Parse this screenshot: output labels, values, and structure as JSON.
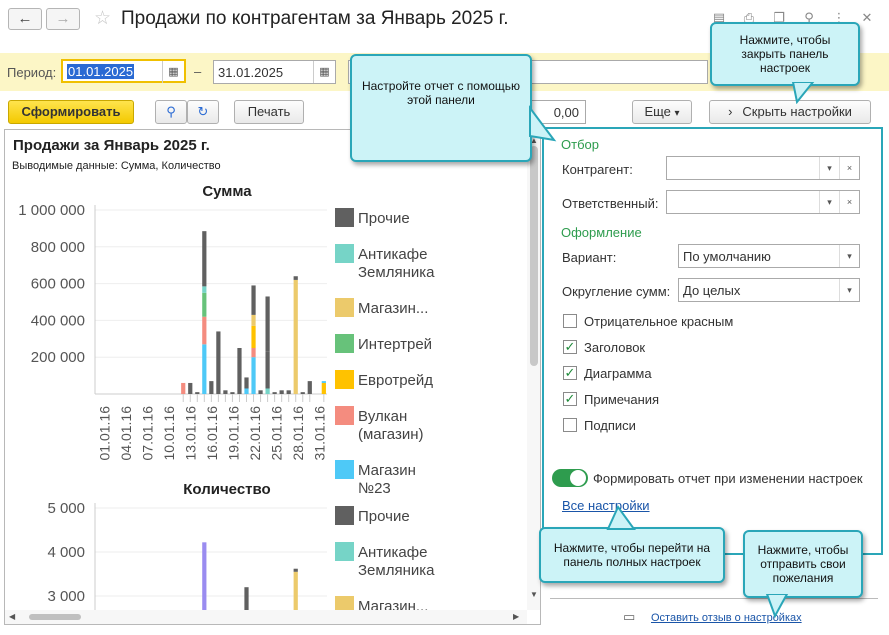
{
  "window": {
    "back_icon": "←",
    "forward_icon": "→",
    "title": "Продажи по контрагентам за Январь 2025 г."
  },
  "params": {
    "period_label": "Период:",
    "date_from": "01.01.2025",
    "dash": "–",
    "date_to": "31.01.2025"
  },
  "toolbar": {
    "generate": "Сформировать",
    "print": "Печать",
    "sum_value": "0,00",
    "more": "Еще",
    "more_arrow": "▾",
    "hide_settings": "Скрыть настройки",
    "hide_arrow": "›"
  },
  "report": {
    "title": "Продажи за Январь 2025 г.",
    "subtitle": "Выводимые данные: Сумма, Количество"
  },
  "chart_data": [
    {
      "type": "bar",
      "stacked": true,
      "title": "Сумма",
      "ylim": [
        0,
        1000000
      ],
      "yticks": [
        "1 000 000",
        "800 000",
        "600 000",
        "400 000",
        "200 000"
      ],
      "xticks": [
        "01.01.16",
        "04.01.16",
        "07.01.16",
        "10.01.16",
        "13.01.16",
        "16.01.16",
        "19.01.16",
        "22.01.16",
        "25.01.16",
        "28.01.16",
        "31.01.16"
      ],
      "legend_position": "right",
      "series": [
        {
          "name": "Прочие",
          "color": "#606060"
        },
        {
          "name": "Антикафе Земляника",
          "color": "#76d4c7"
        },
        {
          "name": "Магазин...",
          "color": "#ecca6b"
        },
        {
          "name": "Интертрейд",
          "color": "#67c27a"
        },
        {
          "name": "Евротрейд",
          "color": "#ffc200"
        },
        {
          "name": "Вулкан (магазин)",
          "color": "#f48c7f"
        },
        {
          "name": "Магазин №23",
          "color": "#4ec9f7"
        }
      ],
      "legend_labels": [
        "Прочие",
        "Антикафе",
        "Земляника",
        "Магазин...",
        "Интертрей",
        "Евротрейд",
        "Вулкан",
        "(магазин)",
        "Магазин",
        "№23"
      ],
      "bars": [
        {
          "day": 13,
          "segments": [
            {
              "s": 5,
              "v": 60000
            }
          ]
        },
        {
          "day": 14,
          "segments": [
            {
              "s": 0,
              "v": 60000
            }
          ]
        },
        {
          "day": 15,
          "segments": [
            {
              "s": 0,
              "v": 10000
            }
          ]
        },
        {
          "day": 16,
          "segments": [
            {
              "s": 6,
              "v": 270000
            },
            {
              "s": 5,
              "v": 150000
            },
            {
              "s": 3,
              "v": 130000
            },
            {
              "s": 1,
              "v": 35000
            },
            {
              "s": 0,
              "v": 300000
            }
          ]
        },
        {
          "day": 17,
          "segments": [
            {
              "s": 0,
              "v": 70000
            }
          ]
        },
        {
          "day": 18,
          "segments": [
            {
              "s": 0,
              "v": 340000
            }
          ]
        },
        {
          "day": 19,
          "segments": [
            {
              "s": 0,
              "v": 20000
            }
          ]
        },
        {
          "day": 20,
          "segments": [
            {
              "s": 0,
              "v": 10000
            }
          ]
        },
        {
          "day": 21,
          "segments": [
            {
              "s": 0,
              "v": 250000
            }
          ]
        },
        {
          "day": 22,
          "segments": [
            {
              "s": 6,
              "v": 30000
            },
            {
              "s": 0,
              "v": 60000
            }
          ]
        },
        {
          "day": 23,
          "segments": [
            {
              "s": 6,
              "v": 200000
            },
            {
              "s": 5,
              "v": 50000
            },
            {
              "s": 4,
              "v": 120000
            },
            {
              "s": 2,
              "v": 60000
            },
            {
              "s": 0,
              "v": 160000
            }
          ]
        },
        {
          "day": 24,
          "segments": [
            {
              "s": 0,
              "v": 20000
            }
          ]
        },
        {
          "day": 25,
          "segments": [
            {
              "s": 1,
              "v": 30000
            },
            {
              "s": 0,
              "v": 200000
            },
            {
              "s": 0,
              "v": 300000
            }
          ]
        },
        {
          "day": 26,
          "segments": [
            {
              "s": 0,
              "v": 10000
            }
          ]
        },
        {
          "day": 27,
          "segments": [
            {
              "s": 0,
              "v": 20000
            }
          ]
        },
        {
          "day": 28,
          "segments": [
            {
              "s": 0,
              "v": 20000
            }
          ]
        },
        {
          "day": 29,
          "segments": [
            {
              "s": 2,
              "v": 620000
            },
            {
              "s": 0,
              "v": 20000
            }
          ]
        },
        {
          "day": 30,
          "segments": [
            {
              "s": 0,
              "v": 10000
            }
          ]
        },
        {
          "day": 31,
          "segments": [
            {
              "s": 0,
              "v": 70000
            }
          ]
        },
        {
          "day": 33,
          "segments": [
            {
              "s": 4,
              "v": 60000
            },
            {
              "s": 6,
              "v": 10000
            }
          ]
        }
      ]
    },
    {
      "type": "bar",
      "stacked": true,
      "title": "Количество",
      "ylim": [
        2500,
        5000
      ],
      "yticks": [
        "5 000",
        "4 000",
        "3 000"
      ],
      "legend_position": "right",
      "legend_labels": [
        "Прочие",
        "Антикафе",
        "Земляника",
        "Магазин..."
      ],
      "bars": [
        {
          "day": 16,
          "segments": [
            {
              "s": 7,
              "v": 4220
            },
            {
              "s": 0,
              "v": 4000
            }
          ]
        },
        {
          "day": 22,
          "segments": [
            {
              "s": 0,
              "v": 3200
            }
          ]
        },
        {
          "day": 23,
          "segments": [
            {
              "s": 0,
              "v": 2500
            }
          ]
        },
        {
          "day": 29,
          "segments": [
            {
              "s": 2,
              "v": 3550
            },
            {
              "s": 0,
              "v": 3620
            }
          ]
        }
      ]
    }
  ],
  "settings": {
    "group_filter": "Отбор",
    "counterparty_label": "Контрагент:",
    "responsible_label": "Ответственный:",
    "group_design": "Оформление",
    "variant_label": "Вариант:",
    "variant_value": "По умолчанию",
    "rounding_label": "Округление сумм:",
    "rounding_value": "До целых",
    "checkboxes": [
      {
        "label": "Отрицательное красным",
        "checked": false
      },
      {
        "label": "Заголовок",
        "checked": true
      },
      {
        "label": "Диаграмма",
        "checked": true
      },
      {
        "label": "Примечания",
        "checked": true
      },
      {
        "label": "Подписи",
        "checked": false
      }
    ],
    "auto_generate_label": "Формировать отчет при изменении настроек",
    "all_settings_link": "Все настройки",
    "feedback_link": "Оставить отзыв о настройках",
    "check_mark": "✓",
    "clear_mark": "×",
    "dd_mark": "▾"
  },
  "callouts": {
    "configure": "Настройте отчет с помощью этой панели",
    "close_panel": "Нажмите, чтобы закрыть панель настроек",
    "full_settings": "Нажмите, чтобы перейти на панель полных настроек",
    "feedback": "Нажмите, чтобы отправить свои пожелания"
  },
  "colors": {
    "accent_teal": "#2aa6b8",
    "callout_bg": "#ccf3f7",
    "param_bg": "#fcf6c6",
    "toggle_green": "#2e9c4e"
  }
}
